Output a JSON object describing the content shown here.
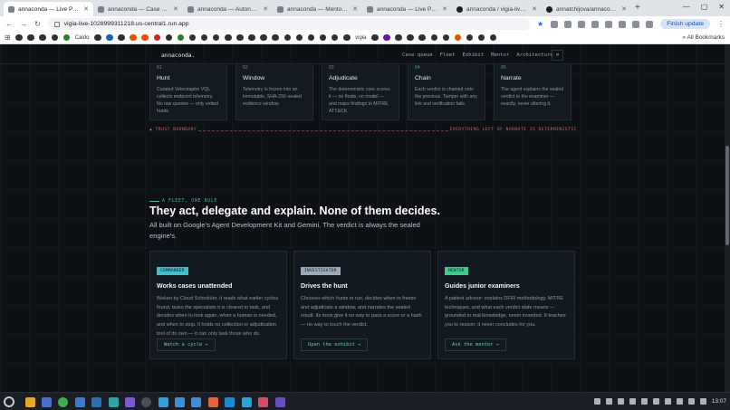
{
  "browser": {
    "tabs": [
      {
        "title": "annaconda — Live Purple Te",
        "active": true,
        "icon": "app-favicon"
      },
      {
        "title": "annaconda — Case Queue",
        "active": false,
        "icon": "app-favicon"
      },
      {
        "title": "annaconda — Autonomous",
        "active": false,
        "icon": "app-favicon"
      },
      {
        "title": "annaconda — Mentor Conv",
        "active": false,
        "icon": "app-favicon"
      },
      {
        "title": "annaconda — Live Purple Te",
        "active": false,
        "icon": "app-favicon"
      },
      {
        "title": "annaconda / vigia-live — sys",
        "active": false,
        "icon": "github-icon"
      },
      {
        "title": "annatchijova/annaconda: Liv",
        "active": false,
        "icon": "github-icon"
      }
    ],
    "new_tab": "+",
    "url": "vigia-live-1028999311218.us-central1.run.app",
    "update_label": "Finish update",
    "bookmarks": [
      "Caido",
      "vigia"
    ],
    "all_bookmarks": "All Bookmarks"
  },
  "site": {
    "brand": "annaconda.",
    "nav": [
      "Case queue",
      "Fleet",
      "Exhibit",
      "Mentor",
      "Architecture"
    ],
    "nav_arrow": "»"
  },
  "pipeline": [
    {
      "num": "01",
      "title": "Hunt",
      "desc": "Curated Velociraptor VQL collects endpoint telemetry. No raw queries — only vetted hunts."
    },
    {
      "num": "02",
      "title": "Window",
      "desc": "Telemetry is frozen into an immutable, SHA-256-sealed evidence window."
    },
    {
      "num": "03",
      "title": "Adjudicate",
      "desc": "The deterministic core scores it — no floats, no model — and maps findings to MITRE ATT&CK."
    },
    {
      "num": "04",
      "title": "Chain",
      "desc": "Each verdict is chained onto the previous. Tamper with any link and verification fails."
    },
    {
      "num": "05",
      "title": "Narrate",
      "desc": "The agent explains the sealed verdict to the examiner — exactly, never altering it."
    }
  ],
  "trust": {
    "left": "▲ TRUST BOUNDARY",
    "right": "EVERYTHING LEFT OF NARRATE IS DETERMINISTIC"
  },
  "fleet": {
    "eyebrow": "A FLEET, ONE RULE",
    "heading": "They act, delegate and explain. None of them decides.",
    "subheading": "All built on Google's Agent Development Kit and Gemini. The verdict is always the sealed engine's.",
    "cards": [
      {
        "badge": "COMMANDER",
        "badge_color": "#3fbfc8",
        "title": "Works cases unattended",
        "desc": "Woken by Cloud Scheduler, it reads what earlier cycles found, tasks the specialists it is cleared to task, and decides when to look again, when a human is needed, and when to stop. It holds no collection or adjudication tool of its own — it can only task those who do.",
        "button": "Watch a cycle →"
      },
      {
        "badge": "INVESTIGATOR",
        "badge_color": "#9aa9b8",
        "title": "Drives the hunt",
        "desc": "Chooses which hunts to run, decides when to freeze and adjudicate a window, and narrates the sealed result. Its tools give it no way to pass a score or a hash — no way to touch the verdict.",
        "button": "Open the exhibit →"
      },
      {
        "badge": "MENTOR",
        "badge_color": "#43c98f",
        "title": "Guides junior examiners",
        "desc": "A patient advisor: explains DFIR methodology, MITRE techniques, and what each verdict state means — grounded in real knowledge, never invented. It teaches you to reason; it never concludes for you.",
        "button": "Ask the mentor →"
      }
    ]
  },
  "system": {
    "clock": "13:07"
  }
}
